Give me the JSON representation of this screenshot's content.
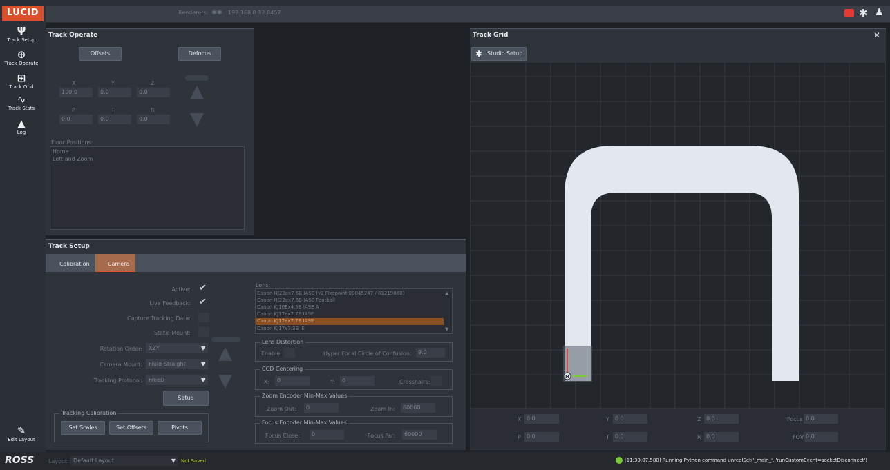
{
  "topbar": {
    "logo": "LUCID",
    "renderer_label": "Renderers:",
    "renderer_ip": "192.168.0.12:8457"
  },
  "sidebar": {
    "items": [
      {
        "label": "Track Setup",
        "icon": "wrench-icon"
      },
      {
        "label": "Track Operate",
        "icon": "crosshair-icon"
      },
      {
        "label": "Track Grid",
        "icon": "grid-icon"
      },
      {
        "label": "Track Stats",
        "icon": "graph-icon"
      },
      {
        "label": "Log",
        "icon": "warning-icon"
      }
    ],
    "edit_layout": "Edit Layout"
  },
  "track_operate": {
    "title": "Track Operate",
    "offsets_btn": "Offsets",
    "defocus_btn": "Defocus",
    "x_label": "X",
    "y_label": "Y",
    "z_label": "Z",
    "x_val": "100.0",
    "y_val": "0.0",
    "z_val": "0.0",
    "p_label": "P",
    "t_label": "T",
    "r_label": "R",
    "p_val": "0.0",
    "t_val": "0.0",
    "r_val": "0.0",
    "floor_positions_label": "Floor Positions:",
    "floor_positions": [
      "Home",
      "Left and Zoom"
    ]
  },
  "track_setup": {
    "title": "Track Setup",
    "tabs": [
      "Calibration",
      "Camera"
    ],
    "active_tab": "Camera",
    "active_label": "Active:",
    "live_feedback_label": "Live Feedback:",
    "capture_tracking_label": "Capture Tracking Data:",
    "static_mount_label": "Static Mount:",
    "rotation_order_label": "Rotation Order:",
    "rotation_order_val": "XZY",
    "camera_mount_label": "Camera Mount:",
    "camera_mount_val": "Fluid Straight",
    "tracking_protocol_label": "Tracking Protocol:",
    "tracking_protocol_val": "FreeD",
    "setup_btn": "Setup",
    "tracking_calibration_label": "Tracking Calibration",
    "set_scales_btn": "Set Scales",
    "set_offsets_btn": "Set Offsets",
    "pivots_btn": "Pivots",
    "lens_label": "Lens:",
    "lens_list": [
      "Canon HJ22ex7.6B IASE (v2 Fixepoint 00045247 / 01219060)",
      "Canon HJ22ex7.6B IASE Football",
      "Canon KJ10Ex4.5B IASE A",
      "Canon KJ17ex7.7B IASE",
      "Canon KJ17ex7.7B IASE",
      "Canon KJ17x7.3B IE"
    ],
    "lens_selected_index": 4,
    "lens_distortion_label": "Lens Distortion",
    "enable_label": "Enable:",
    "hyper_focal_label": "Hyper Focal Circle of Confusion:",
    "hyper_focal_val": "9.0",
    "ccd_label": "CCD Centering",
    "ccd_x_label": "X:",
    "ccd_x_val": "0",
    "ccd_y_label": "Y:",
    "ccd_y_val": "0",
    "crosshairs_label": "Crosshairs:",
    "zoom_label": "Zoom Encoder Min-Max Values",
    "zoom_out_label": "Zoom Out:",
    "zoom_out_val": "0",
    "zoom_in_label": "Zoom In:",
    "zoom_in_val": "60000",
    "focus_label": "Focus Encoder Min-Max Values",
    "focus_close_label": "Focus Close:",
    "focus_close_val": "0",
    "focus_far_label": "Focus Far:",
    "focus_far_val": "60000"
  },
  "track_grid": {
    "title": "Track Grid",
    "close": "✕",
    "studio_setup_btn": "Studio Setup",
    "marker_label": "H",
    "readouts": {
      "x_label": "X",
      "x_val": "0.0",
      "y_label": "Y",
      "y_val": "0.0",
      "z_label": "Z",
      "z_val": "0.0",
      "focus_label": "Focus",
      "focus_val": "0.0",
      "p_label": "P",
      "p_val": "0.0",
      "t_label": "T",
      "t_val": "0.0",
      "r_label": "R",
      "r_val": "0.0",
      "fov_label": "FOV",
      "fov_val": "0.0"
    }
  },
  "statusbar": {
    "ross_logo": "ROSS",
    "layout_label": "Layout:",
    "layout_val": "Default Layout",
    "not_saved": "Not Saved",
    "log_message": "[11:39:07.580] Running Python command unreelSet('_main_', 'runCustomEvent=socketDisconnect')"
  },
  "colors": {
    "accent": "#d9502b",
    "active_tab": "#a66a4c",
    "selected_row": "#8b4f22",
    "track_shape": "#e3e7ee",
    "not_saved": "#c4d82f",
    "ok_green": "#7cc83b"
  }
}
